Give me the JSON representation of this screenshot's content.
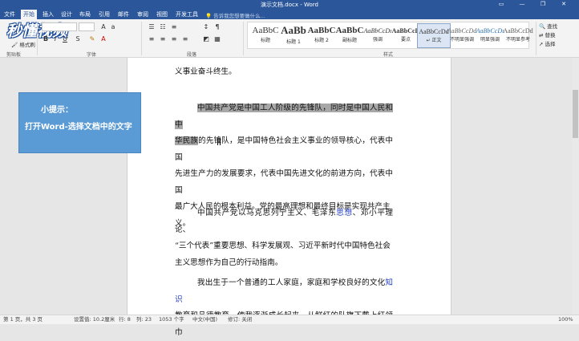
{
  "window": {
    "title": "演示文档.docx - Word",
    "controls": [
      "▭",
      "—",
      "❐",
      "✕"
    ]
  },
  "tabs": [
    "文件",
    "开始",
    "插入",
    "设计",
    "布局",
    "引用",
    "邮件",
    "审阅",
    "视图",
    "开发工具"
  ],
  "active_tab": "开始",
  "tell_me": "告诉我您想要做什么...",
  "ribbon": {
    "clipboard_label": "剪贴板",
    "format_painter": "格式刷",
    "font_label": "字体",
    "paragraph_label": "段落",
    "styles_label": "样式",
    "logo_text": "秒懂视频",
    "styles": [
      {
        "sample": "AaBbC",
        "name": "标题"
      },
      {
        "sample": "AaBb",
        "name": "标题 1"
      },
      {
        "sample": "AaBbC",
        "name": "标题 2"
      },
      {
        "sample": "AaBbC",
        "name": "副标题"
      },
      {
        "sample": "AaBbCcDı",
        "name": "强调"
      },
      {
        "sample": "AaBbCcD",
        "name": "要点"
      },
      {
        "sample": "AaBbCcDd",
        "name": "↵ 正文"
      },
      {
        "sample": "AaBbCcDd",
        "name": "不明显强调"
      },
      {
        "sample": "AaBbCcDı",
        "name": "明显强调"
      },
      {
        "sample": "AaBbCcDd",
        "name": "不明显参考"
      }
    ],
    "editing": [
      "查找",
      "替换",
      "选择"
    ]
  },
  "document": {
    "p0_tail": "义事业奋斗终生。",
    "p1_highlight_a": "中国共产党是中国工人阶级的先锋队，同时是中国人民和中",
    "p1_highlight_b": "华民族",
    "p1_rest_line2": "的先锋队，是中国特色社会主义事业的领导核心，代表中国",
    "p1_line3": "先进生产力的发展要求，代表中国先进文化的前进方向，代表中国",
    "p1_line4": "最广大人民的根本利益。党的最高理想和最终目标是实现共产主",
    "p1_line5": "义。",
    "p2_line1_a": "中国共产党以马克思列宁主义、毛泽东",
    "p2_line1_link": "思想",
    "p2_line1_b": "、邓小平理论、",
    "p2_line2": "“三个代表”重要思想、科学发展观、习近平新时代中国特色社会",
    "p2_line3": "主义思想作为自己的行动指南。",
    "p3_line1_a": "我出生于一个普通的工人家庭，家庭和学校良好的文化",
    "p3_line1_link": "知识",
    "p3_line2": "教育和品德教育，使我逐渐成长起来，从鲜红的队旗下戴上红领巾"
  },
  "tip": {
    "title": "小提示：",
    "text": "打开Word-选择文档中的文字"
  },
  "status": {
    "page": "第 1 页，共 3 页",
    "position": "设置值: 10.2厘米",
    "line": "行: 8",
    "col": "列: 23",
    "words": "1053 个字",
    "lang": "中文(中国)",
    "mode": "修订: 关闭",
    "zoom": "100%"
  }
}
